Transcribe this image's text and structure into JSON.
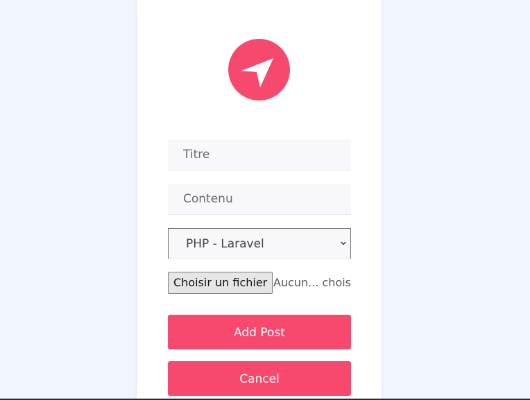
{
  "form": {
    "title_placeholder": "Titre",
    "content_placeholder": "Contenu",
    "category_selected": "PHP - Laravel",
    "file_button_label": "Choisir un fichier",
    "file_status": "Aucun... choisi",
    "add_button_label": "Add Post",
    "cancel_button_label": "Cancel"
  },
  "logo": {
    "icon": "navigation-arrow-icon",
    "color": "#f7496e"
  },
  "colors": {
    "accent": "#f7496e",
    "page_background": "#f0f5fe",
    "card_background": "#ffffff",
    "input_background": "#f8f8fb"
  }
}
